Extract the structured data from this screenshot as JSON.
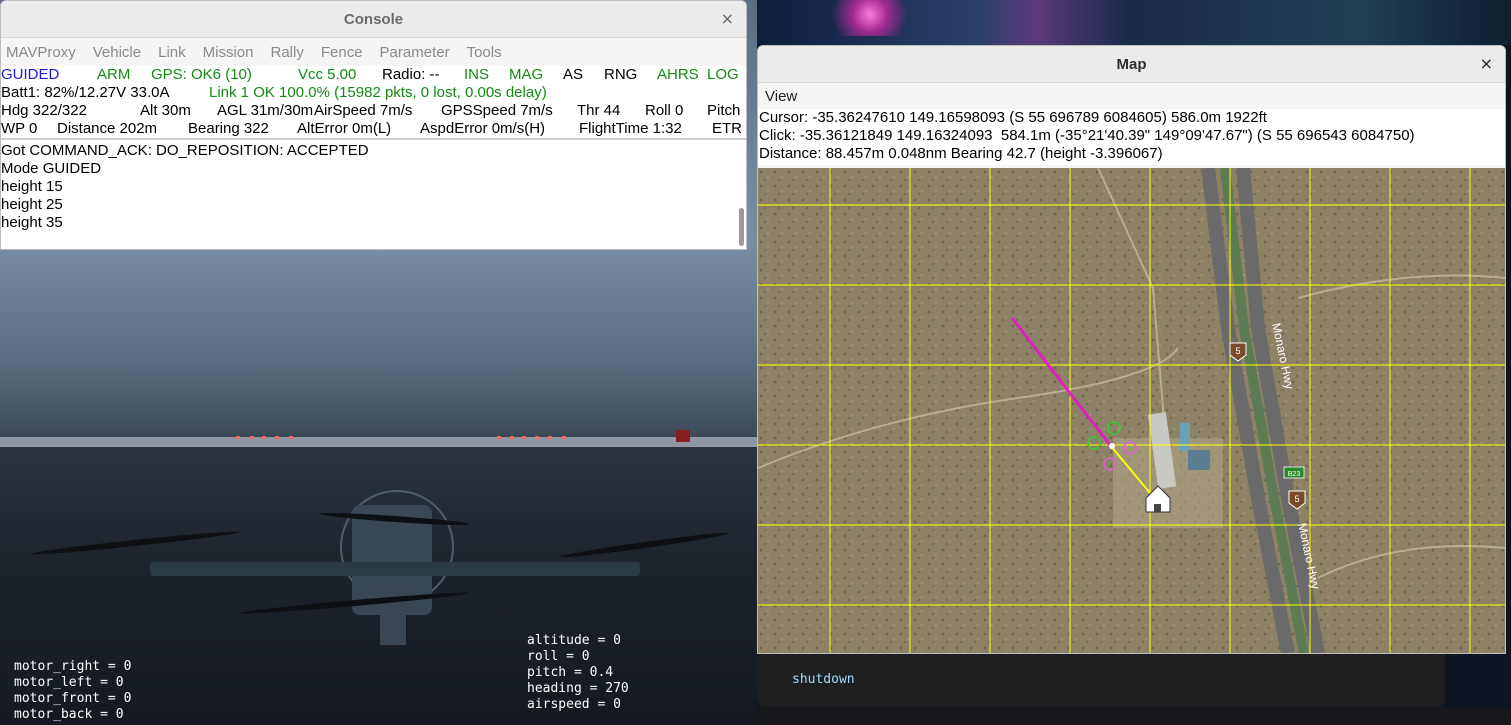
{
  "console": {
    "title": "Console",
    "close": "×",
    "menu": [
      "MAVProxy",
      "Vehicle",
      "Link",
      "Mission",
      "Rally",
      "Fence",
      "Parameter",
      "Tools"
    ],
    "status_row1": [
      {
        "text": "GUIDED",
        "color": "#1a1ad6"
      },
      {
        "text": "ARM",
        "color": "#138a13"
      },
      {
        "text": "GPS: OK6 (10)",
        "color": "#138a13"
      },
      {
        "text": "Vcc 5.00",
        "color": "#138a13"
      },
      {
        "text": "Radio: --",
        "color": "#000000"
      },
      {
        "text": "INS",
        "color": "#138a13"
      },
      {
        "text": "MAG",
        "color": "#138a13"
      },
      {
        "text": "AS",
        "color": "#000000"
      },
      {
        "text": "RNG",
        "color": "#000000"
      },
      {
        "text": "AHRS",
        "color": "#138a13"
      },
      {
        "text": "LOG",
        "color": "#138a13"
      }
    ],
    "batt": "Batt1: 82%/12.27V 33.0A",
    "link": "Link 1 OK 100.0% (15982 pkts, 0 lost, 0.00s delay)",
    "status_row3": [
      "Hdg 322/322",
      "Alt 30m",
      "AGL 31m/30m",
      "AirSpeed 7m/s",
      "GPSSpeed 7m/s",
      "Thr 44",
      "Roll 0",
      "Pitch"
    ],
    "status_row4": [
      "WP 0",
      "Distance 202m",
      "Bearing 322",
      "AltError 0m(L)",
      "AspdError 0m/s(H)",
      "FlightTime 1:32",
      "ETR"
    ],
    "log": [
      "Got COMMAND_ACK: DO_REPOSITION: ACCEPTED",
      "Mode GUIDED",
      "height 15",
      "height 25",
      "height 35"
    ]
  },
  "map": {
    "title": "Map",
    "close": "×",
    "menu": [
      "View"
    ],
    "cursor": "Cursor: -35.36247610 149.16598093 (S 55 696789 6084605) 586.0m 1922ft",
    "click": "Click: -35.36121849 149.16324093  584.1m (-35°21'40.39\" 149°09'47.67\") (S 55 696543 6084750)",
    "distance": "Distance: 88.457m 0.048nm Bearing 42.7 (height -3.396067)",
    "road_label": "Monaro Hwy",
    "route_shield_5": "5",
    "route_shield_b23": "B23",
    "colors": {
      "grid": "#ffff00",
      "track": "#e020c0",
      "path": "#ffff00"
    }
  },
  "sim": {
    "left_readout": [
      "motor_right = 0",
      "motor_left = 0",
      "motor_front = 0",
      "motor_back = 0"
    ],
    "right_readout": [
      "altitude = 0",
      "roll = 0",
      "pitch = 0.4",
      "heading = 270",
      "airspeed = 0"
    ]
  },
  "terminal": {
    "line": "shutdown"
  }
}
